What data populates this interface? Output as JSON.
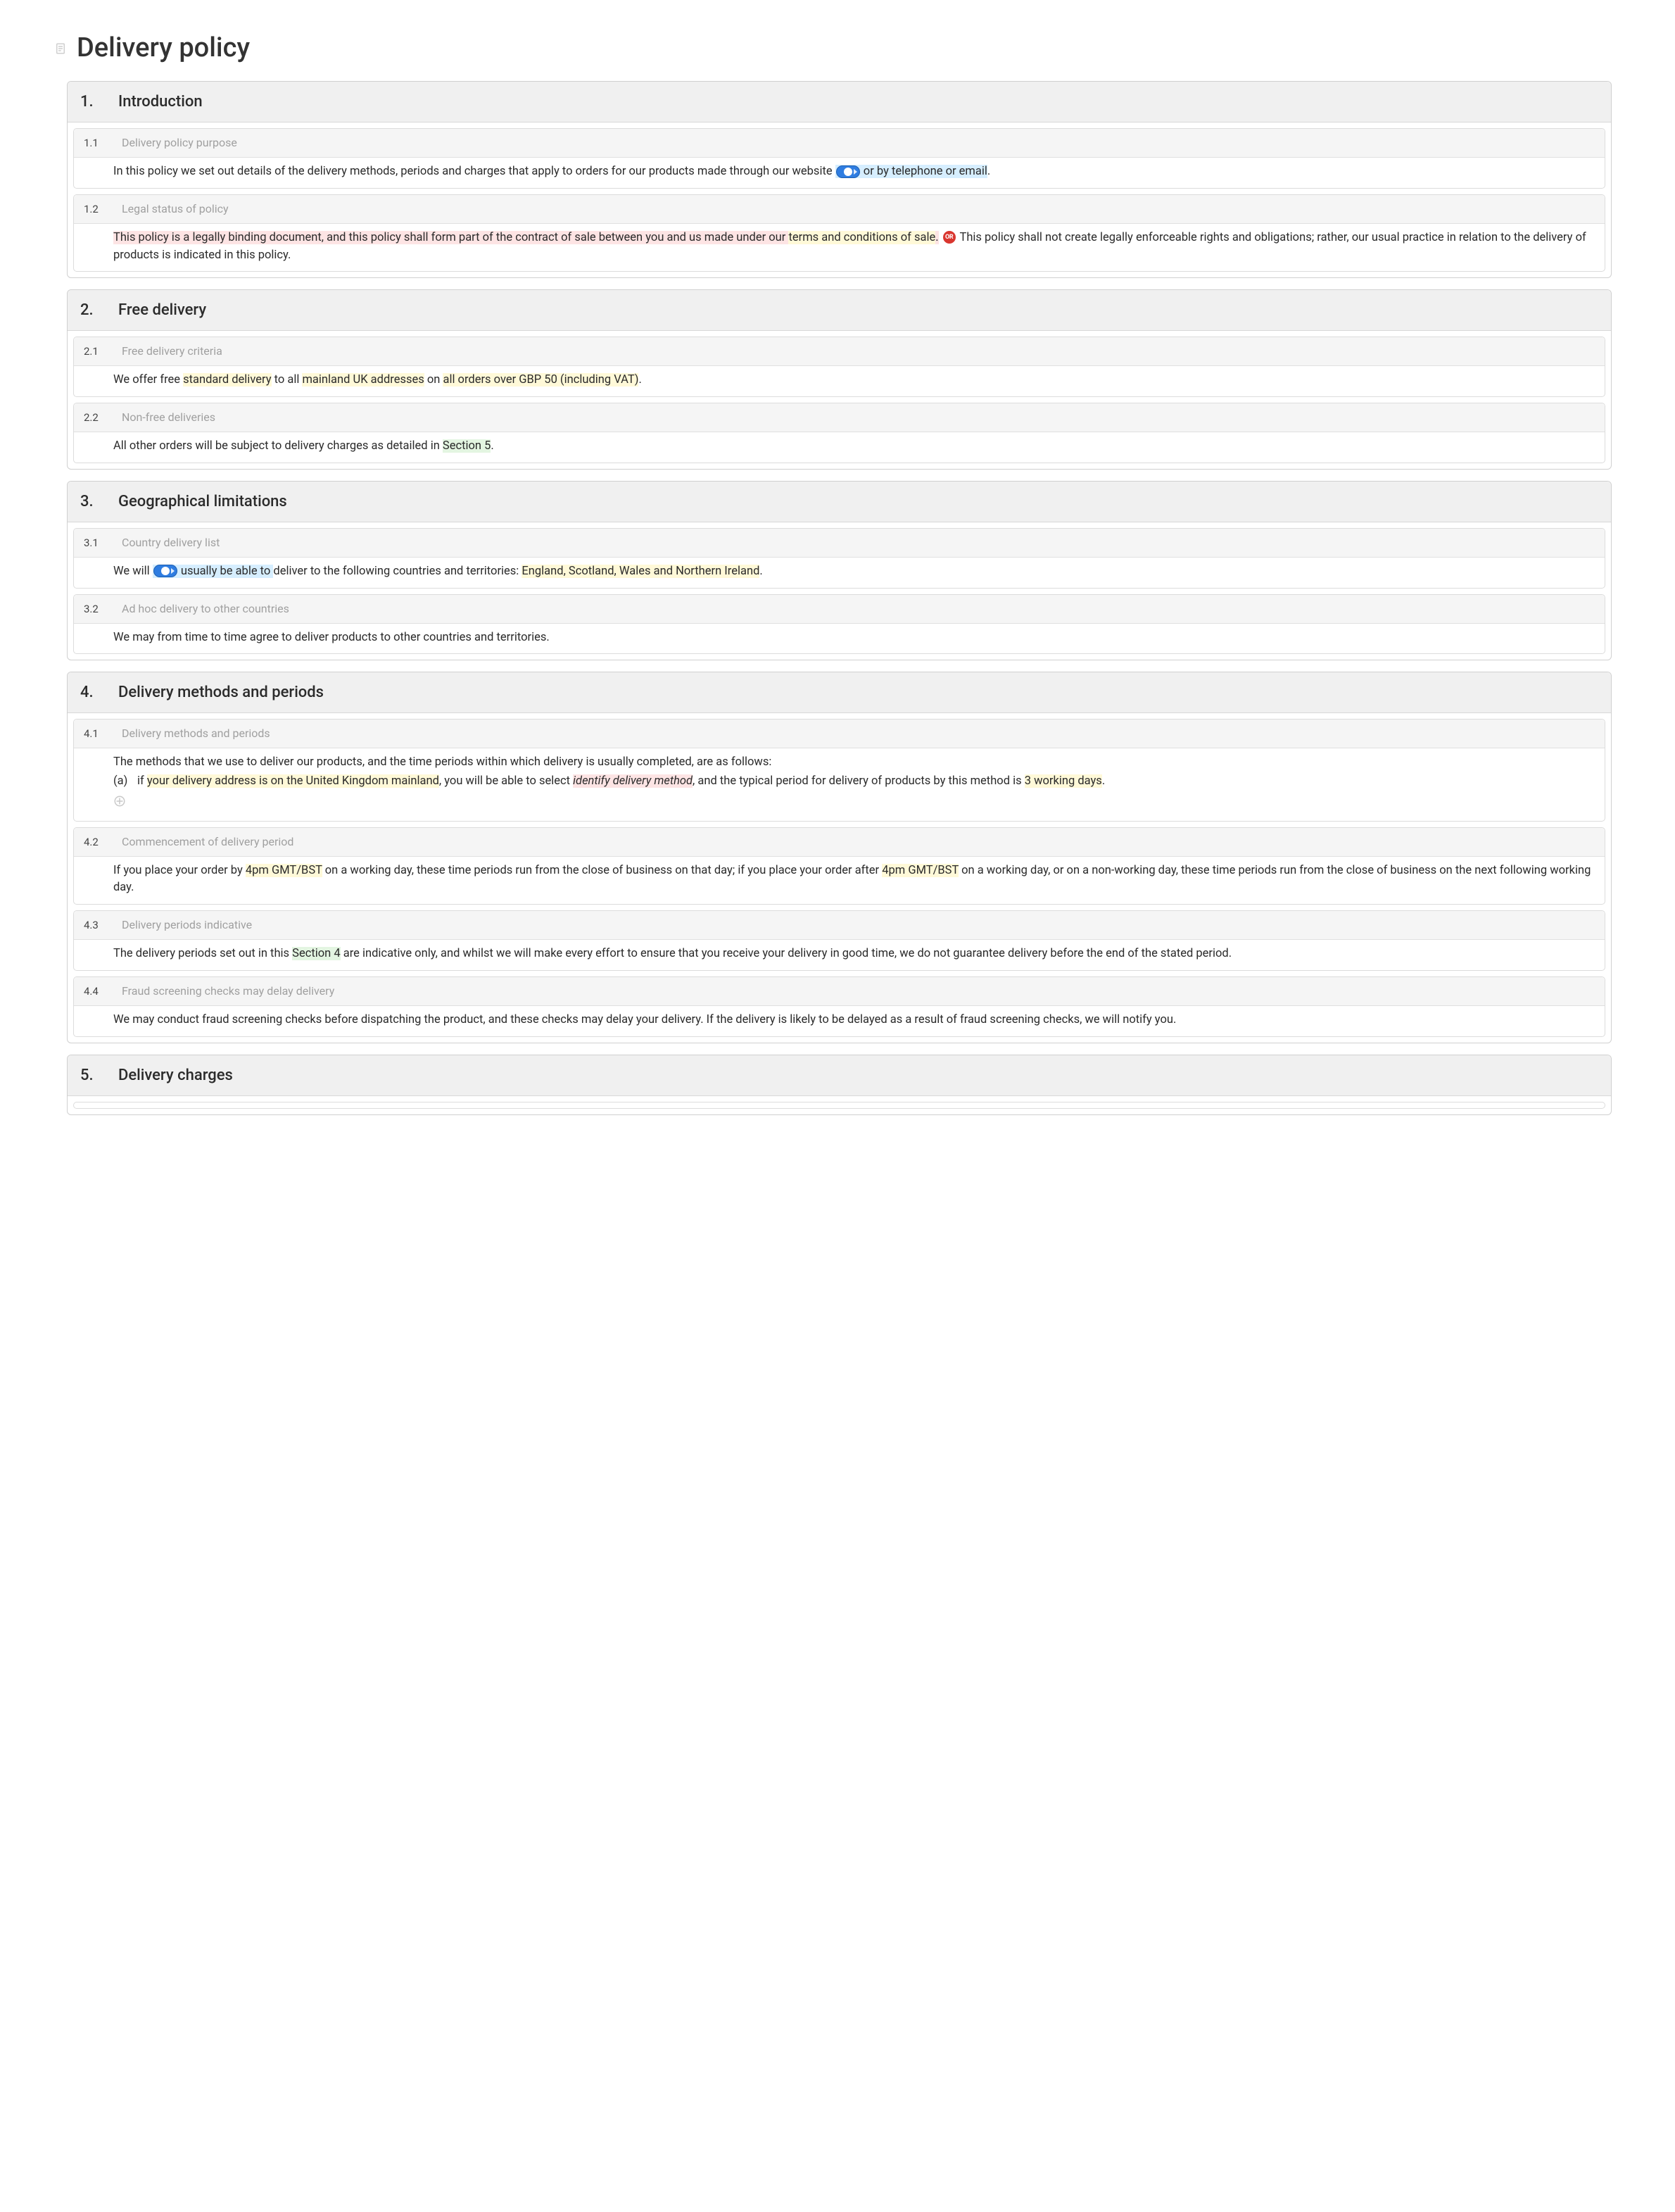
{
  "title": "Delivery policy",
  "sections": [
    {
      "num": "1.",
      "title": "Introduction",
      "subs": [
        {
          "num": "1.1",
          "title": "Delivery policy purpose",
          "t1": "In this policy we set out details of the delivery methods, periods and charges that apply to orders for our products made through our website ",
          "t2_hl": " or by telephone or email",
          "t3": "."
        },
        {
          "num": "1.2",
          "title": "Legal status of policy",
          "t1_hl": "This policy is a legally binding document, and this policy shall form part of the contract of sale between you and us made under our ",
          "t2_hl": "terms and conditions of sale",
          "t3_hl": ".",
          "or": "OR",
          "t4": " This policy shall not create legally enforceable rights and obligations; rather, our usual practice in relation to the delivery of products is indicated in this policy."
        }
      ]
    },
    {
      "num": "2.",
      "title": "Free delivery",
      "subs": [
        {
          "num": "2.1",
          "title": "Free delivery criteria",
          "t1": "We offer free ",
          "t2_hl": "standard delivery",
          "t3": " to all ",
          "t4_hl": "mainland UK addresses",
          "t5": " on ",
          "t6_hl": "all orders over GBP 50 (including VAT)",
          "t7": "."
        },
        {
          "num": "2.2",
          "title": "Non-free deliveries",
          "t1": "All other orders will be subject to delivery charges as detailed in ",
          "t2_hl": "Section 5",
          "t3": "."
        }
      ]
    },
    {
      "num": "3.",
      "title": "Geographical limitations",
      "subs": [
        {
          "num": "3.1",
          "title": "Country delivery list",
          "t1": "We will ",
          "t2_hl": " usually be able to ",
          "t3": "deliver to the following countries and territories: ",
          "t4_hl": "England, Scotland, Wales and Northern Ireland",
          "t5": "."
        },
        {
          "num": "3.2",
          "title": "Ad hoc delivery to other countries",
          "t1": "We may from time to time agree to deliver products to other countries and territories."
        }
      ]
    },
    {
      "num": "4.",
      "title": "Delivery methods and periods",
      "subs": [
        {
          "num": "4.1",
          "title": "Delivery methods and periods",
          "intro": "The methods that we use to deliver our products, and the time periods within which delivery is usually completed, are as follows:",
          "letter": "(a)",
          "a1": "if ",
          "a2_hl": "your delivery address is on the United Kingdom mainland",
          "a3": ", you will be able to select ",
          "a4_hl": "identify delivery method",
          "a5": ", and the typical period for delivery of products by this method is ",
          "a6_hl": "3 working days",
          "a7": "."
        },
        {
          "num": "4.2",
          "title": "Commencement of delivery period",
          "t1": "If you place your order by ",
          "t2_hl": "4pm GMT/BST",
          "t3": " on a working day, these time periods run from the close of business on that day; if you place your order after ",
          "t4_hl": "4pm GMT/BST",
          "t5": " on a working day, or on a non-working day, these time periods run from the close of business on the next following working day."
        },
        {
          "num": "4.3",
          "title": "Delivery periods indicative",
          "t1": "The delivery periods set out in this ",
          "t2_hl": "Section 4",
          "t3": " are indicative only, and whilst we will make every effort to ensure that you receive your delivery in good time, we do not guarantee delivery before the end of the stated period."
        },
        {
          "num": "4.4",
          "title": "Fraud screening checks may delay delivery",
          "t1": "We may conduct fraud screening checks before dispatching the product, and these checks may delay your delivery. If the delivery is likely to be delayed as a result of fraud screening checks, we will notify you."
        }
      ]
    },
    {
      "num": "5.",
      "title": "Delivery charges",
      "subs": []
    }
  ]
}
